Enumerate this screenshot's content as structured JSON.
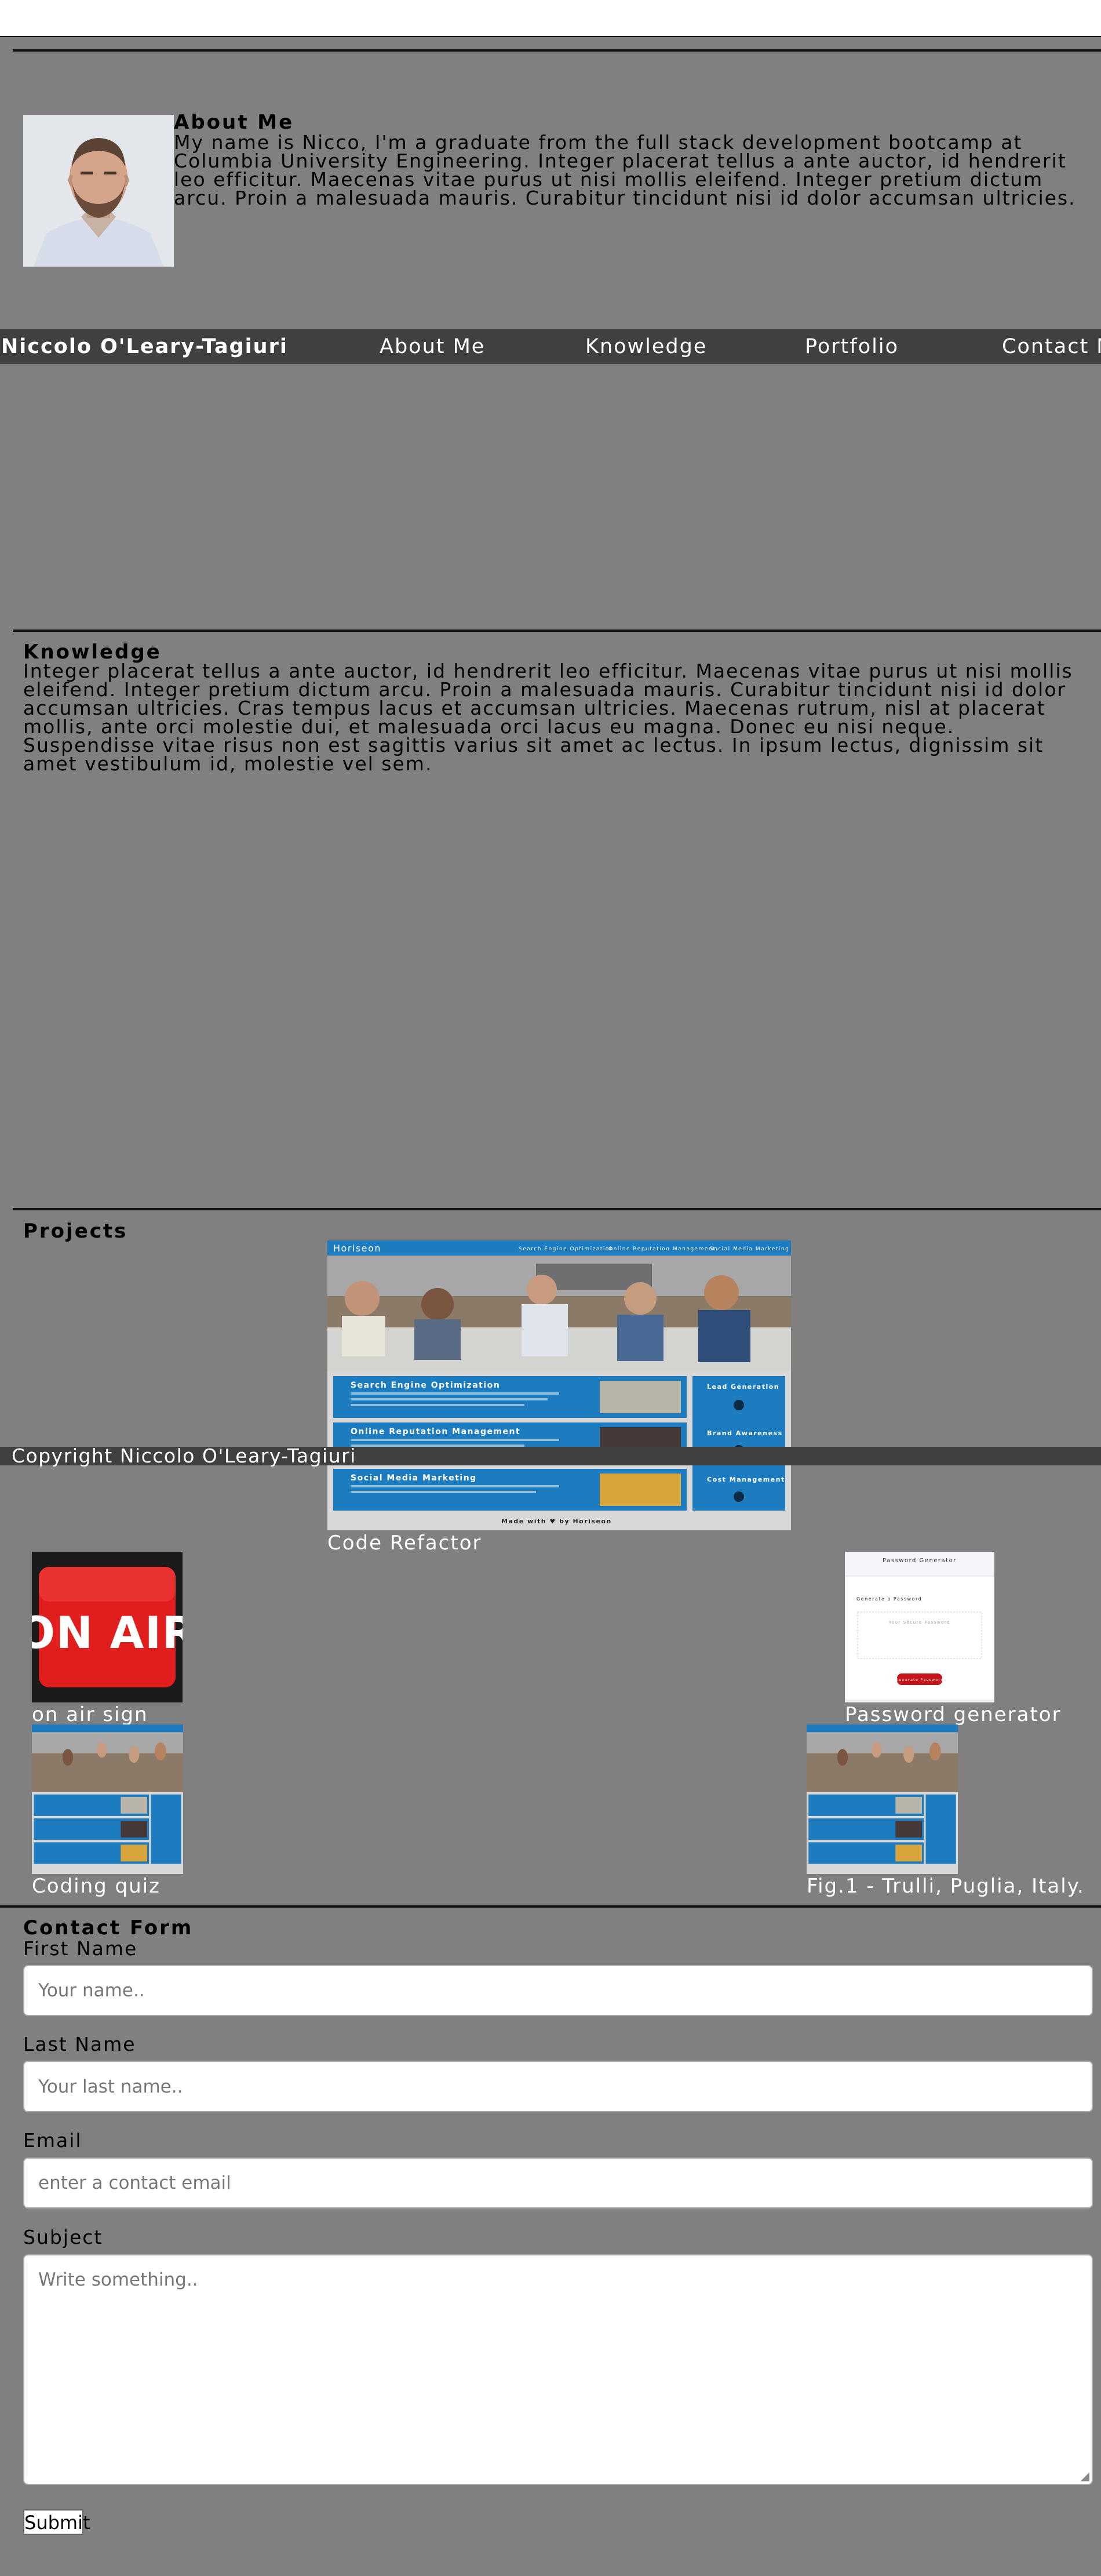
{
  "about": {
    "title": "About Me",
    "text": "My name is Nicco, I'm a graduate from the full stack development bootcamp at Columbia University Engineering. Integer placerat tellus a ante auctor, id hendrerit leo efficitur. Maecenas vitae purus ut nisi mollis eleifend. Integer pretium dictum arcu. Proin a malesuada mauris. Curabitur tincidunt nisi id dolor accumsan ultricies."
  },
  "nav": {
    "brand": "Niccolo O'Leary-Tagiuri",
    "items": [
      "About Me",
      "Knowledge",
      "Portfolio",
      "Contact M"
    ]
  },
  "knowledge": {
    "title": "Knowledge",
    "text": "Integer placerat tellus a ante auctor, id hendrerit leo efficitur. Maecenas vitae purus ut nisi mollis eleifend. Integer pretium dictum arcu. Proin a malesuada mauris. Curabitur tincidunt nisi id dolor accumsan ultricies. Cras tempus lacus et accumsan ultricies. Maecenas rutrum, nisl at placerat mollis, ante orci molestie dui, et malesuada orci lacus eu magna. Donec eu nisi neque. Suspendisse vitae risus non est sagittis varius sit amet ac lectus. In ipsum lectus, dignissim sit amet vestibulum id, molestie vel sem."
  },
  "projects": {
    "title": "Projects",
    "items": [
      {
        "caption": "Code Refactor"
      },
      {
        "caption": "on air sign",
        "sign_text": "ON AIR"
      },
      {
        "caption": "Password generator"
      },
      {
        "caption": "Coding quiz"
      },
      {
        "caption": "Fig.1 - Trulli, Puglia, Italy."
      }
    ]
  },
  "horiseon_preview": {
    "brand": "Horiseon",
    "nav": [
      "Search Engine Optimization",
      "Online Reputation Management",
      "Social Media Marketing"
    ],
    "cards": [
      "Search Engine Optimization",
      "Online Reputation Management",
      "Social Media Marketing"
    ],
    "side": [
      "Lead Generation",
      "Brand Awareness",
      "Cost Management"
    ],
    "footer": "Made with ♥ by Horiseon"
  },
  "password_preview": {
    "title": "Password Generator",
    "subtitle": "Generate a Password",
    "placeholder": "Your Secure Password",
    "button": "Generate Password"
  },
  "footer": {
    "text": "Copyright Niccolo O'Leary-Tagiuri"
  },
  "contact": {
    "title": "Contact Form",
    "first_name_label": "First Name",
    "first_name_placeholder": "Your name..",
    "last_name_label": "Last Name",
    "last_name_placeholder": "Your last name..",
    "email_label": "Email",
    "email_placeholder": "enter a contact email",
    "subject_label": "Subject",
    "subject_placeholder": "Write something..",
    "submit_label": "Submit"
  },
  "colors": {
    "page_bg": "#808080",
    "nav_bg": "#404040",
    "rule": "#111111",
    "horiseon_blue": "#1d7bbf",
    "on_air_red": "#e01e1e"
  }
}
